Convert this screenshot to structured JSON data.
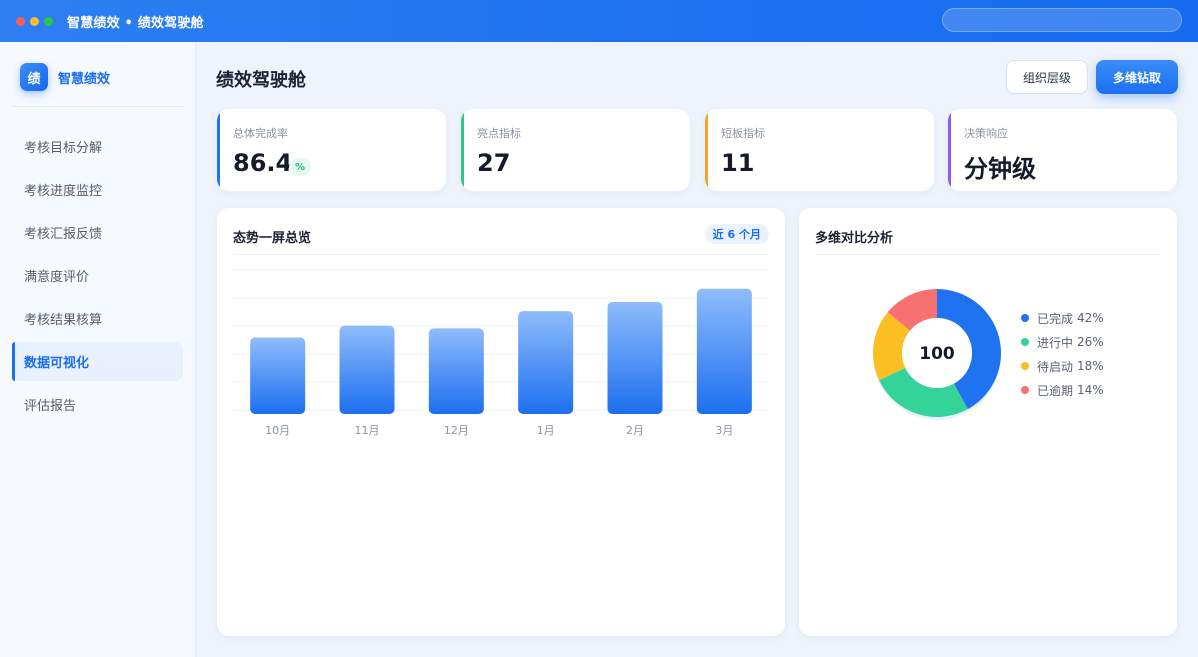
{
  "window": {
    "title": "智慧绩效 • 绩效驾驶舱"
  },
  "sidebar": {
    "brand_logo": "绩",
    "brand_name": "智慧绩效",
    "items": [
      {
        "label": "考核目标分解",
        "active": false
      },
      {
        "label": "考核进度监控",
        "active": false
      },
      {
        "label": "考核汇报反馈",
        "active": false
      },
      {
        "label": "满意度评价",
        "active": false
      },
      {
        "label": "考核结果核算",
        "active": false
      },
      {
        "label": "数据可视化",
        "active": true
      },
      {
        "label": "评估报告",
        "active": false
      }
    ]
  },
  "header": {
    "title": "绩效驾驶舱",
    "secondary_button": "组织层级",
    "primary_button": "多维钻取"
  },
  "kpis": [
    {
      "label": "总体完成率",
      "value": "86.4",
      "unit": "%",
      "color": "#1f72f0"
    },
    {
      "label": "亮点指标",
      "value": "27",
      "color": "#2fc58a"
    },
    {
      "label": "短板指标",
      "value": "11",
      "color": "#f3a42a"
    },
    {
      "label": "决策响应",
      "value": "分钟级",
      "color": "#8b5cf6"
    }
  ],
  "trend_card": {
    "title": "态势一屏总览",
    "range": "近 6 个月"
  },
  "compare_card": {
    "title": "多维对比分析",
    "center_value": "100",
    "legend": [
      {
        "label": "已完成",
        "value": "42%",
        "color": "#1f72f0"
      },
      {
        "label": "进行中",
        "value": "26%",
        "color": "#34d399"
      },
      {
        "label": "待启动",
        "value": "18%",
        "color": "#fbbf24"
      },
      {
        "label": "已逾期",
        "value": "14%",
        "color": "#f87171"
      }
    ]
  },
  "chart_data": [
    {
      "type": "bar",
      "categories": [
        "10月",
        "11月",
        "12月",
        "1月",
        "2月",
        "3月"
      ],
      "values": [
        58,
        67,
        65,
        78,
        85,
        95
      ],
      "ylim": [
        0,
        110
      ],
      "grid": true
    },
    {
      "type": "pie",
      "categories": [
        "已完成",
        "进行中",
        "待启动",
        "已逾期"
      ],
      "values": [
        42,
        26,
        18,
        14
      ],
      "colors": [
        "#1f72f0",
        "#34d399",
        "#fbbf24",
        "#f87171"
      ]
    }
  ]
}
